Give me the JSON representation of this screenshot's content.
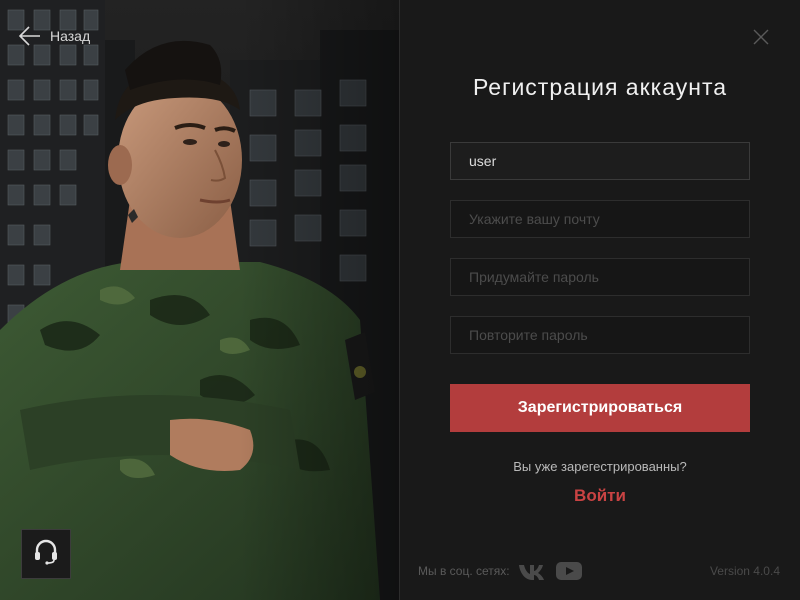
{
  "nav": {
    "back_label": "Назад"
  },
  "form": {
    "title": "Регистрация аккаунта",
    "username_value": "user",
    "email_placeholder": "Укажите вашу почту",
    "password_placeholder": "Придумайте пароль",
    "password_repeat_placeholder": "Повторите пароль",
    "submit_label": "Зарегистрироваться",
    "already_registered_text": "Вы уже зарегестрированны?",
    "login_label": "Войти"
  },
  "footer": {
    "social_label": "Мы в соц. сетях:",
    "social_icons": [
      "vk-icon",
      "youtube-icon"
    ],
    "version": "Version 4.0.4"
  },
  "icons": {
    "back": "arrow-left-icon",
    "close": "close-icon",
    "support": "headset-icon"
  },
  "colors": {
    "accent": "#b33d3d",
    "login_link": "#c94343",
    "panel_bg": "#191919",
    "field_bg": "#161616"
  }
}
